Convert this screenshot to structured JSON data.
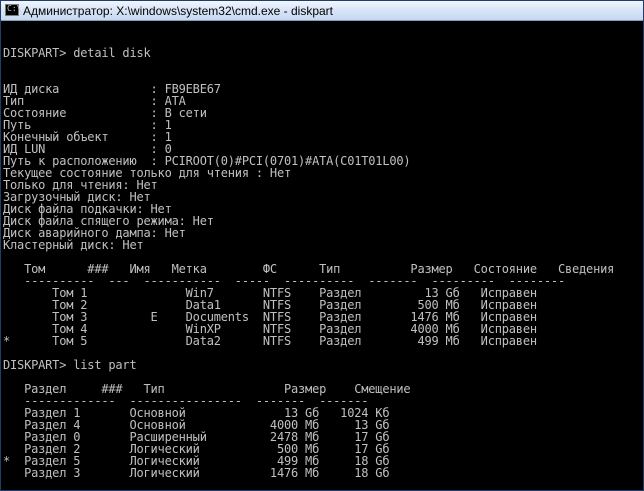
{
  "window": {
    "title": "Администратор: X:\\windows\\system32\\cmd.exe - diskpart",
    "icon_prompt": "C:\\"
  },
  "console": {
    "text": "\n\nDISKPART> detail disk\n\n\nИД диска             : FB9EBE67\nТип                  : ATA\nСостояние            : В сети\nПуть                 : 1\nКонечный объект      : 1\nИД LUN               : 0\nПуть к расположению  : PCIROOT(0)#PCI(0701)#ATA(C01T01L00)\nТекущее состояние только для чтения : Нет\nТолько для чтения: Нет\nЗагрузочный диск: Нет\nДиск файла подкачки: Нет\nДиск файла спящего режима: Нет\nДиск аварийного дампа: Нет\nКластерный диск: Нет\n\n   Том      ###   Имя   Метка        ФС      Тип          Размер   Состояние   Сведения\n   ----------  ---  -----------  -----  ----------  -------  ---------  --------\n       Том 1              Win7       NTFS    Раздел         13 Gб   Исправен\n       Том 2              Data1      NTFS    Раздел        500 Мб   Исправен\n       Том 3         E    Documents  NTFS    Раздел       1476 Мб   Исправен\n       Том 4              WinXP      NTFS    Раздел       4000 Мб   Исправен\n*      Том 5              Data2      NTFS    Раздел        499 Мб   Исправен\n\nDISKPART> list part\n\n   Раздел     ###   Тип                 Размер    Смещение\n   -------------  ----------------  -------  -------\n   Раздел 1       Основной              13 Gб   1024 Кб\n   Раздел 4       Основной            4000 Мб     13 Gб\n   Раздел 0       Расширенный         2478 Мб     17 Gб\n   Раздел 2       Логический           500 Мб     17 Gб\n*  Раздел 5       Логический           499 Мб     18 Gб\n   Раздел 3       Логический          1476 Мб     18 Gб\n\nDISKPART>"
  }
}
